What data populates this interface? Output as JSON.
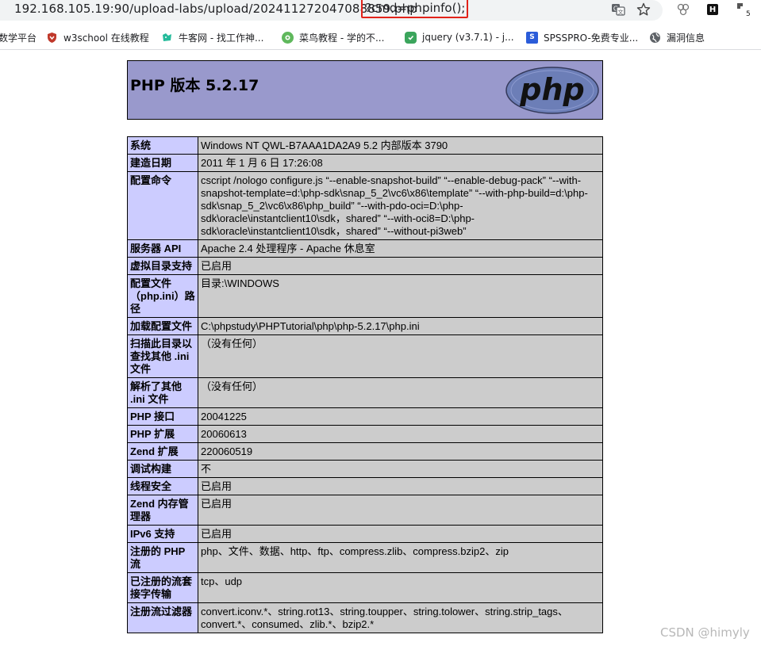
{
  "browser": {
    "url_main": "192.168.105.19:90/upload-labs/upload/202411272047088859.php",
    "url_query": "?cmd=phpinfo();",
    "extension_count": "5",
    "bookmarks": [
      {
        "label": "数学平台",
        "icon": "none"
      },
      {
        "label": "w3school 在线教程",
        "icon": "shield-icon"
      },
      {
        "label": "牛客网 - 找工作神...",
        "icon": "niuke-icon"
      },
      {
        "label": "菜鸟教程 - 学的不...",
        "icon": "runoob-icon"
      },
      {
        "label": "jquery (v3.7.1) - j...",
        "icon": "jquery-icon"
      },
      {
        "label": "SPSSPRO-免费专业...",
        "icon": "s-icon"
      },
      {
        "label": "漏洞信息",
        "icon": "globe-icon"
      }
    ]
  },
  "phpinfo": {
    "title": "PHP 版本 5.2.17",
    "logo_text": "php",
    "rows": [
      {
        "key": "系统",
        "value": "Windows NT QWL-B7AAA1DA2A9 5.2 内部版本 3790"
      },
      {
        "key": "建造日期",
        "value": "2011 年 1 月 6 日 17:26:08"
      },
      {
        "key": "配置命令",
        "value": "cscript /nologo configure.js “--enable-snapshot-build” “--enable-debug-pack” “--with-snapshot-template=d:\\php-sdk\\snap_5_2\\vc6\\x86\\template” “--with-php-build=d:\\php-sdk\\snap_5_2\\vc6\\x86\\php_build” “--with-pdo-oci=D:\\php-sdk\\oracle\\instantclient10\\sdk，shared” “--with-oci8=D:\\php-sdk\\oracle\\instantclient10\\sdk，shared” “--without-pi3web”"
      },
      {
        "key": "服务器 API",
        "value": "Apache 2.4 处理程序 - Apache 休息室"
      },
      {
        "key": "虚拟目录支持",
        "value": "已启用"
      },
      {
        "key": "配置文件（php.ini）路径",
        "value": "目录:\\WINDOWS"
      },
      {
        "key": "加载配置文件",
        "value": "C:\\phpstudy\\PHPTutorial\\php\\php-5.2.17\\php.ini"
      },
      {
        "key": "扫描此目录以查找其他 .ini 文件",
        "value": "（没有任何）"
      },
      {
        "key": "解析了其他 .ini 文件",
        "value": "（没有任何）"
      },
      {
        "key": "PHP 接口",
        "value": "20041225"
      },
      {
        "key": "PHP 扩展",
        "value": "20060613"
      },
      {
        "key": "Zend 扩展",
        "value": "220060519"
      },
      {
        "key": "调试构建",
        "value": "不"
      },
      {
        "key": "线程安全",
        "value": "已启用"
      },
      {
        "key": "Zend 内存管理器",
        "value": "已启用"
      },
      {
        "key": "IPv6 支持",
        "value": "已启用"
      },
      {
        "key": "注册的 PHP 流",
        "value": "php、文件、数据、http、ftp、compress.zlib、compress.bzip2、zip"
      },
      {
        "key": "已注册的流套接字传输",
        "value": "tcp、udp"
      },
      {
        "key": "注册流过滤器",
        "value": "convert.iconv.*、string.rot13、string.toupper、string.tolower、string.strip_tags、convert.*、consumed、zlib.*、bzip2.*"
      }
    ]
  },
  "watermark": "CSDN @himyly",
  "colors": {
    "header_bg": "#9999cc",
    "key_bg": "#ccccff",
    "value_bg": "#cccccc",
    "highlight_border": "#e2231a"
  }
}
